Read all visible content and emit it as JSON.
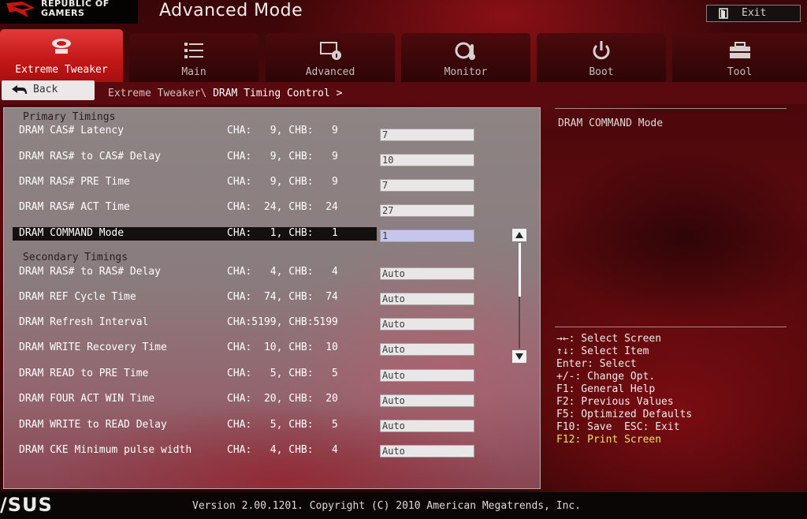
{
  "brand": {
    "line1": "REPUBLIC OF",
    "line2": "GAMERS",
    "vendor_logo": "/SUS"
  },
  "header": {
    "title": "Advanced Mode",
    "exit_label": "Exit"
  },
  "tabs": [
    {
      "label": "Extreme Tweaker",
      "icon": "rog-eye-icon",
      "active": true
    },
    {
      "label": "Main",
      "icon": "list-icon",
      "active": false
    },
    {
      "label": "Advanced",
      "icon": "advanced-settings-icon",
      "active": false
    },
    {
      "label": "Monitor",
      "icon": "monitor-gauge-icon",
      "active": false
    },
    {
      "label": "Boot",
      "icon": "power-icon",
      "active": false
    },
    {
      "label": "Tool",
      "icon": "toolbox-icon",
      "active": false
    }
  ],
  "nav": {
    "back_label": "Back",
    "breadcrumb_parent": "Extreme Tweaker\\",
    "breadcrumb_current": "DRAM Timing Control >"
  },
  "sections": {
    "primary": "Primary Timings",
    "secondary": "Secondary Timings"
  },
  "rows": [
    {
      "label": "DRAM CAS# Latency",
      "channels": "CHA:   9, CHB:   9",
      "value": "7"
    },
    {
      "label": "DRAM RAS# to CAS# Delay",
      "channels": "CHA:   9, CHB:   9",
      "value": "10"
    },
    {
      "label": "DRAM RAS# PRE Time",
      "channels": "CHA:   9, CHB:   9",
      "value": "7"
    },
    {
      "label": "DRAM RAS# ACT Time",
      "channels": "CHA:  24, CHB:  24",
      "value": "27"
    },
    {
      "label": "DRAM COMMAND Mode",
      "channels": "CHA:   1, CHB:   1",
      "value": "1",
      "selected": true
    },
    {
      "label": "DRAM RAS# to RAS# Delay",
      "channels": "CHA:   4, CHB:   4",
      "value": "Auto"
    },
    {
      "label": "DRAM REF Cycle Time",
      "channels": "CHA:  74, CHB:  74",
      "value": "Auto"
    },
    {
      "label": "DRAM Refresh Interval",
      "channels": "CHA:5199, CHB:5199",
      "value": "Auto"
    },
    {
      "label": "DRAM WRITE Recovery Time",
      "channels": "CHA:  10, CHB:  10",
      "value": "Auto"
    },
    {
      "label": "DRAM READ to PRE Time",
      "channels": "CHA:   5, CHB:   5",
      "value": "Auto"
    },
    {
      "label": "DRAM FOUR ACT WIN Time",
      "channels": "CHA:  20, CHB:  20",
      "value": "Auto"
    },
    {
      "label": "DRAM WRITE to READ Delay",
      "channels": "CHA:   5, CHB:   5",
      "value": "Auto"
    },
    {
      "label": "DRAM CKE Minimum pulse width",
      "channels": "CHA:   4, CHB:   4",
      "value": "Auto"
    }
  ],
  "help": {
    "title": "DRAM COMMAND Mode",
    "keys": [
      "→←: Select Screen",
      "↑↓: Select Item",
      "Enter: Select",
      "+/-: Change Opt.",
      "F1: General Help",
      "F2: Previous Values",
      "F5: Optimized Defaults",
      "F10: Save  ESC: Exit",
      "F12: Print Screen"
    ]
  },
  "footer": {
    "version": "Version 2.00.1201. Copyright (C) 2010 American Megatrends, Inc."
  },
  "colors": {
    "active_tab": "#c51818",
    "panel": "#8e8484",
    "highlight_text": "#f0e060",
    "selected_field": "#c5c5ee"
  }
}
